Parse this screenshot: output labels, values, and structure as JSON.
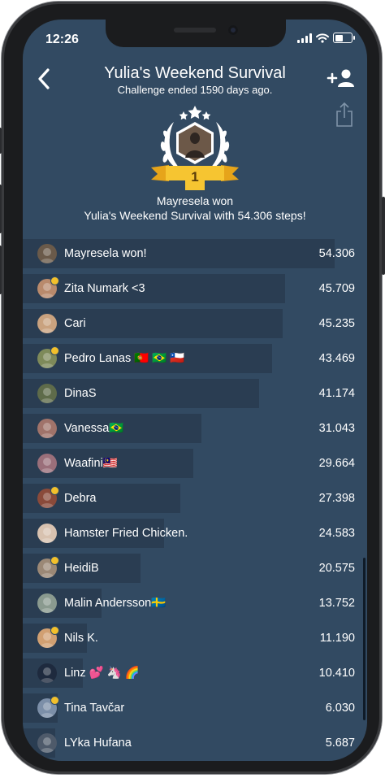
{
  "status_bar": {
    "time": "12:26"
  },
  "header": {
    "title": "Yulia's Weekend Survival",
    "subtitle": "Challenge ended 1590 days ago."
  },
  "winner": {
    "place": "1",
    "line1": "Mayresela won",
    "line2": "Yulia's Weekend Survival with 54.306 steps!"
  },
  "ranking": [
    {
      "name": "Mayresela won!",
      "value": "54.306",
      "steps": 54306,
      "badge": false,
      "avatar_color": "#6a5a4a"
    },
    {
      "name": "Zita Numark  <3",
      "value": "45.709",
      "steps": 45709,
      "badge": true,
      "avatar_color": "#b98a6c"
    },
    {
      "name": "Cari",
      "value": "45.235",
      "steps": 45235,
      "badge": false,
      "avatar_color": "#c9a27f"
    },
    {
      "name": "Pedro Lanas 🇵🇹 🇧🇷 🇨🇱",
      "value": "43.469",
      "steps": 43469,
      "badge": true,
      "avatar_color": "#7e8a5a"
    },
    {
      "name": "DinaS",
      "value": "41.174",
      "steps": 41174,
      "badge": false,
      "avatar_color": "#5e6b4a"
    },
    {
      "name": "Vanessa🇧🇷",
      "value": "31.043",
      "steps": 31043,
      "badge": false,
      "avatar_color": "#a0736a"
    },
    {
      "name": "Waafini🇲🇾",
      "value": "29.664",
      "steps": 29664,
      "badge": false,
      "avatar_color": "#9a6f7a"
    },
    {
      "name": "Debra",
      "value": "27.398",
      "steps": 27398,
      "badge": true,
      "avatar_color": "#8a4a3a"
    },
    {
      "name": "Hamster Fried Chicken.",
      "value": "24.583",
      "steps": 24583,
      "badge": false,
      "avatar_color": "#d8c2b0"
    },
    {
      "name": "HeidiB",
      "value": "20.575",
      "steps": 20575,
      "badge": true,
      "avatar_color": "#9b8876"
    },
    {
      "name": "Malin Andersson🇸🇪",
      "value": "13.752",
      "steps": 13752,
      "badge": false,
      "avatar_color": "#8a9a8f"
    },
    {
      "name": "Nils K.",
      "value": "11.190",
      "steps": 11190,
      "badge": true,
      "avatar_color": "#d1a072"
    },
    {
      "name": "Linz 💕 🦄 🌈",
      "value": "10.410",
      "steps": 10410,
      "badge": false,
      "avatar_color": "#1e2a3e"
    },
    {
      "name": "Tina Tavčar",
      "value": "6.030",
      "steps": 6030,
      "badge": true,
      "avatar_color": "#7c8fa8"
    },
    {
      "name": "LYka Hufana",
      "value": "5.687",
      "steps": 5687,
      "badge": false,
      "avatar_color": "#4e5a6a"
    }
  ],
  "icons": [
    "back-chevron-icon",
    "add-user-icon",
    "share-icon",
    "laurel-icon",
    "star-icon",
    "signal-icon",
    "wifi-icon",
    "battery-icon"
  ]
}
